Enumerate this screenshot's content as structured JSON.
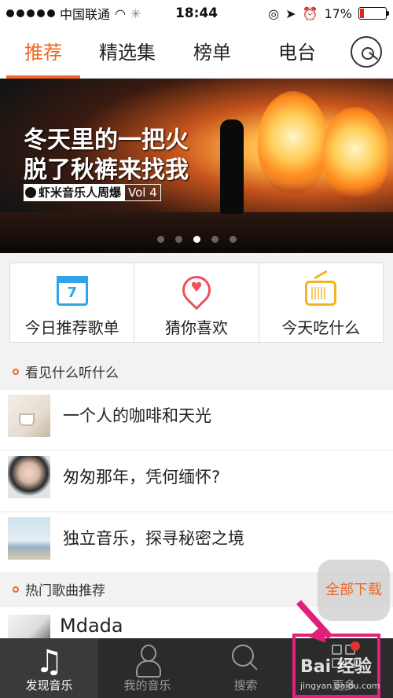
{
  "status_bar": {
    "carrier": "中国联通",
    "time": "18:44",
    "battery": "17%",
    "battery_level": 0.17
  },
  "tabs": [
    {
      "label": "推荐",
      "active": true
    },
    {
      "label": "精选集",
      "active": false
    },
    {
      "label": "榜单",
      "active": false
    },
    {
      "label": "电台",
      "active": false
    }
  ],
  "banner": {
    "title_line1": "冬天里的一把火",
    "title_line2": "脱了秋裤来找我",
    "brand_main": "虾米音乐人周爆",
    "brand_vol": "Vol 4",
    "page_count": 5,
    "active_page": 3
  },
  "quick_entries": [
    {
      "label": "今日推荐歌单",
      "icon": "calendar-icon",
      "icon_text": "7",
      "color": "#2fa4e7"
    },
    {
      "label": "猜你喜欢",
      "icon": "heart-pin-icon",
      "color": "#f0505a"
    },
    {
      "label": "今天吃什么",
      "icon": "radio-icon",
      "color": "#f5b31f"
    }
  ],
  "section1": {
    "title": "看见什么听什么"
  },
  "list1": [
    {
      "title": "一个人的咖啡和天光"
    },
    {
      "title": "匆匆那年，凭何缅怀?"
    },
    {
      "title": "独立音乐，探寻秘密之境"
    }
  ],
  "section2": {
    "title": "热门歌曲推荐"
  },
  "list2": [
    {
      "title": "Mdada"
    }
  ],
  "fab": {
    "label": "全部下载"
  },
  "bottom_nav": [
    {
      "label": "发现音乐",
      "icon": "music-note-icon",
      "active": true
    },
    {
      "label": "我的音乐",
      "icon": "person-icon",
      "active": false
    },
    {
      "label": "搜索",
      "icon": "search-icon",
      "active": false
    },
    {
      "label": "更多",
      "icon": "grid-icon",
      "active": false
    }
  ],
  "watermark": {
    "text": "Bai 经验",
    "url": "jingyan.baidu.com"
  },
  "colors": {
    "accent": "#f26522",
    "nav_bg": "#2b2b2b"
  }
}
